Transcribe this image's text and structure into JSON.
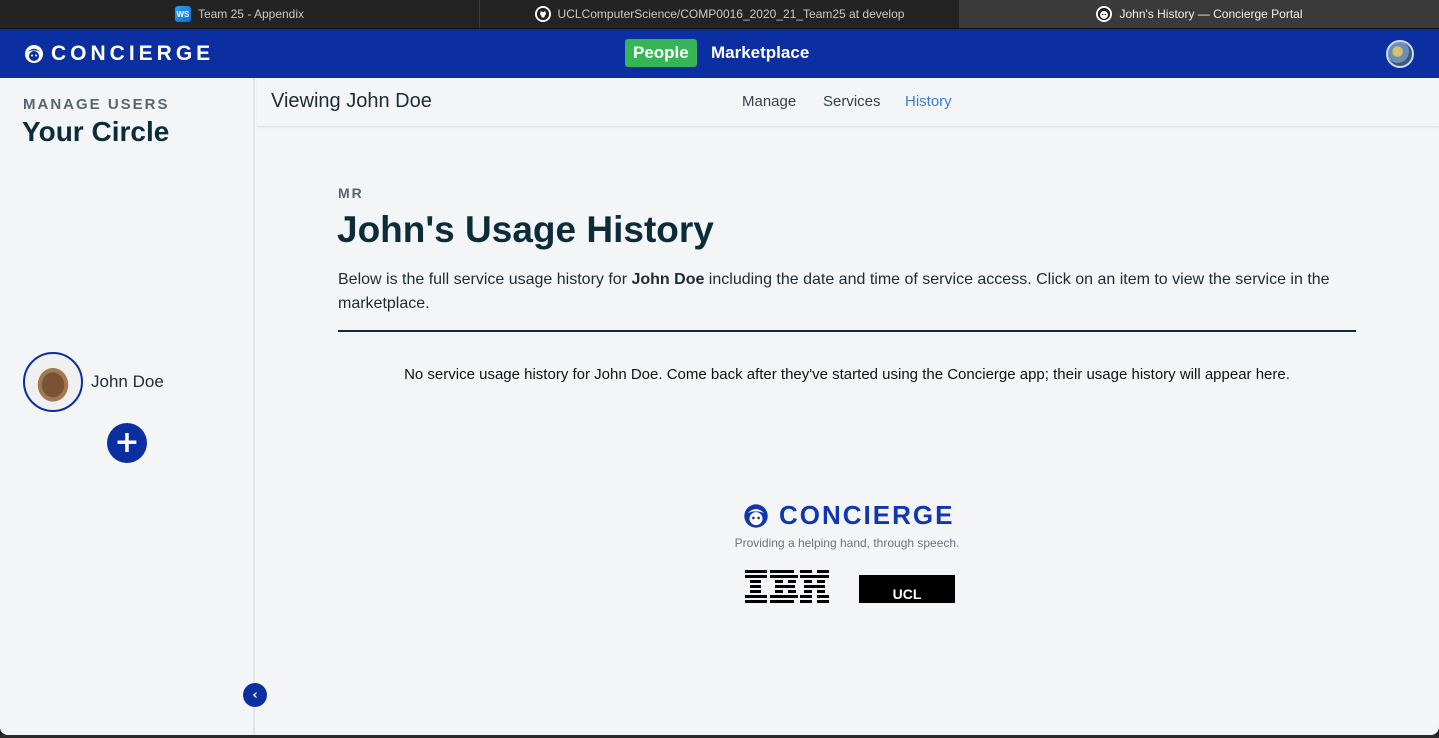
{
  "browser": {
    "tabs": [
      {
        "title": "Team 25 - Appendix",
        "icon": "webstorm-icon"
      },
      {
        "title": "UCLComputerScience/COMP0016_2020_21_Team25 at develop",
        "icon": "github-icon"
      },
      {
        "title": "John's History — Concierge Portal",
        "icon": "concierge-icon"
      }
    ],
    "active_tab": 2
  },
  "topnav": {
    "brand": "CONCIERGE",
    "people": "People",
    "marketplace": "Marketplace",
    "colors": {
      "bar": "#0b2fa0",
      "people_active": "#35b555"
    }
  },
  "sidebar": {
    "overline": "MANAGE USERS",
    "title": "Your Circle",
    "members": [
      {
        "name": "John Doe"
      }
    ],
    "add_label": "+",
    "collapse_label": "‹"
  },
  "subheader": {
    "viewing": "Viewing John Doe",
    "tabs": [
      "Manage",
      "Services",
      "History"
    ],
    "active": "History"
  },
  "main": {
    "overline": "MR",
    "heading": "John's Usage History",
    "desc_prefix": "Below is the full service usage history for ",
    "desc_name": "John Doe",
    "desc_suffix": " including the date and time of service access. Click on an item to view the service in the marketplace.",
    "empty": "No service usage history for John Doe. Come back after they've started using the Concierge app; their usage history will appear here."
  },
  "footer": {
    "brand": "CONCIERGE",
    "tagline": "Providing a helping hand, through speech.",
    "ucl": "UCL"
  }
}
